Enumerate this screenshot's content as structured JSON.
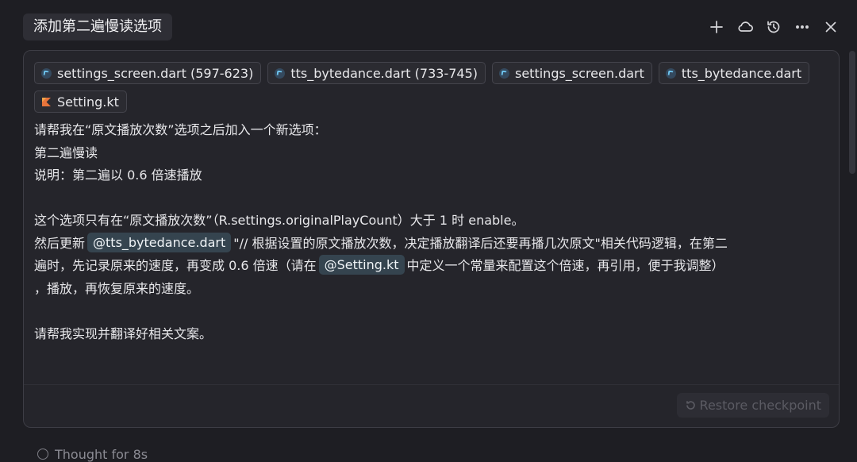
{
  "header": {
    "title": "添加第二遍慢读选项",
    "actions": [
      {
        "name": "new-chat-icon",
        "glyph": "plus"
      },
      {
        "name": "cloud-icon",
        "glyph": "cloud"
      },
      {
        "name": "history-icon",
        "glyph": "history"
      },
      {
        "name": "more-icon",
        "glyph": "ellipsis"
      },
      {
        "name": "close-icon",
        "glyph": "x"
      }
    ]
  },
  "context_chips": [
    {
      "label": "settings_screen.dart (597-623)",
      "icon": "dart-icon"
    },
    {
      "label": "tts_bytedance.dart (733-745)",
      "icon": "dart-icon"
    },
    {
      "label": "settings_screen.dart",
      "icon": "dart-icon"
    },
    {
      "label": "tts_bytedance.dart",
      "icon": "dart-icon"
    },
    {
      "label": "Setting.kt",
      "icon": "kotlin-icon"
    }
  ],
  "message": {
    "line1": "请帮我在“原文播放次数”选项之后加入一个新选项：",
    "line2": "第二遍慢读",
    "line3": "说明：第二遍以 0.6 倍速播放",
    "line4": "这个选项只有在“原文播放次数”（R.settings.originalPlayCount）大于 1 时 enable。",
    "line5_before": "然后更新",
    "mention1": "@tts_bytedance.dart",
    "line5_after": "\"// 根据设置的原文播放次数，决定播放翻译后还要再播几次原文\"相关代码逻辑，在第二",
    "line6_before": "遍时，先记录原来的速度，再变成 0.6 倍速（请在",
    "mention2": "@Setting.kt",
    "line6_after": "中定义一个常量来配置这个倍速，再引用，便于我调整）",
    "line7": "，播放，再恢复原来的速度。",
    "line8": "请帮我实现并翻译好相关文案。"
  },
  "restore_label": "Restore checkpoint",
  "thought_label": "Thought for 8s",
  "colors": {
    "background": "#1e1e23",
    "card": "#25252b",
    "mention_bg": "#35444f",
    "dart_blue": "#6ec6f0",
    "kotlin_orange": "#e8743b"
  }
}
